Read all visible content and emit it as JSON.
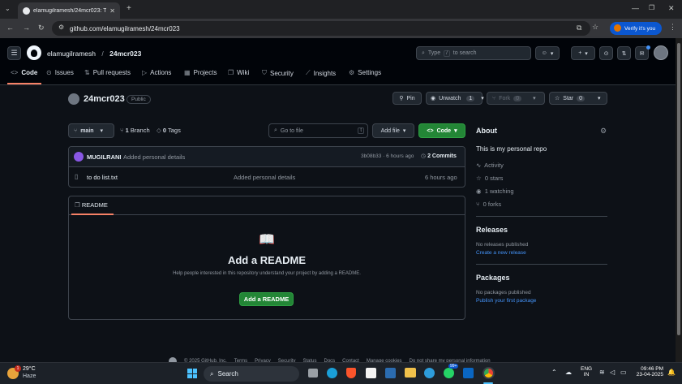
{
  "browser": {
    "tab_title": "elamugilramesh/24mcr023: Th",
    "url": "github.com/elamugilramesh/24mcr023",
    "verify_label": "Verify it's you"
  },
  "header": {
    "owner": "elamugilramesh",
    "separator": "/",
    "repo": "24mcr023",
    "search_placeholder": "Type / to search",
    "search_prefix": "Type",
    "search_suffix": "to search"
  },
  "nav": {
    "tabs": [
      {
        "label": "Code",
        "icon": "code-icon",
        "active": true
      },
      {
        "label": "Issues",
        "icon": "issue-icon"
      },
      {
        "label": "Pull requests",
        "icon": "pull-request-icon"
      },
      {
        "label": "Actions",
        "icon": "actions-icon"
      },
      {
        "label": "Projects",
        "icon": "projects-icon"
      },
      {
        "label": "Wiki",
        "icon": "book-icon"
      },
      {
        "label": "Security",
        "icon": "shield-icon"
      },
      {
        "label": "Insights",
        "icon": "graph-icon"
      },
      {
        "label": "Settings",
        "icon": "gear-icon"
      }
    ]
  },
  "repo": {
    "name": "24mcr023",
    "visibility": "Public",
    "pin_label": "Pin",
    "unwatch_label": "Unwatch",
    "watch_count": "1",
    "fork_label": "Fork",
    "fork_count": "0",
    "star_label": "Star",
    "star_count": "0"
  },
  "toolbar": {
    "branch": "main",
    "branch_count": "1",
    "branch_label": "Branch",
    "tag_count": "0",
    "tag_label": "Tags",
    "go_to_file": "Go to file",
    "go_to_file_key": "t",
    "add_file": "Add file",
    "code_button": "Code"
  },
  "commit": {
    "author": "MUGILRANI",
    "message": "Added personal details",
    "hash_time": "3b08b33 · 6 hours ago",
    "commit_count": "2",
    "commits_label": "Commits"
  },
  "files": [
    {
      "name": "to do list.txt",
      "message": "Added personal details",
      "time": "6 hours ago"
    }
  ],
  "readme": {
    "tab_label": "README",
    "heading": "Add a README",
    "description": "Help people interested in this repository understand your project by adding a README.",
    "button": "Add a README"
  },
  "about": {
    "title": "About",
    "description": "This is my personal repo",
    "activity": "Activity",
    "stars": "0 stars",
    "watching": "1 watching",
    "forks": "0 forks"
  },
  "releases": {
    "title": "Releases",
    "empty": "No releases published",
    "link": "Create a new release"
  },
  "packages": {
    "title": "Packages",
    "empty": "No packages published",
    "link": "Publish your first package"
  },
  "footer": {
    "text": "© 2025 GitHub, Inc.",
    "links": [
      "Terms",
      "Privacy",
      "Security",
      "Status",
      "Docs",
      "Contact",
      "Manage cookies",
      "Do not share my personal information"
    ]
  },
  "taskbar": {
    "weather_temp": "29°C",
    "weather_desc": "Haze",
    "weather_badge": "1",
    "search_label": "Search",
    "lang_top": "ENG",
    "lang_bottom": "IN",
    "time": "09:46 PM",
    "date": "23-04-2025",
    "whatsapp_badge": "99+"
  },
  "colors": {
    "background": "#0d1117",
    "accent_green": "#238636",
    "link_blue": "#4493f8",
    "active_tab_underline": "#f78166"
  }
}
